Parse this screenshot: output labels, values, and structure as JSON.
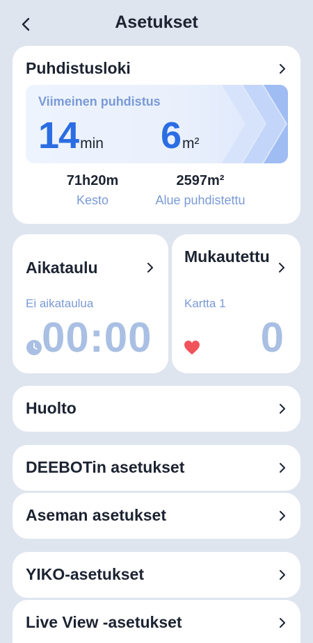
{
  "header": {
    "title": "Asetukset"
  },
  "cleaning_log": {
    "title": "Puhdistusloki",
    "last_label": "Viimeinen puhdistus",
    "last_duration_value": "14",
    "last_duration_unit": "min",
    "last_area_value": "6",
    "last_area_unit": "m²",
    "total_duration_value": "71h20m",
    "total_duration_label": "Kesto",
    "total_area_value": "2597m²",
    "total_area_label": "Alue puhdistettu"
  },
  "schedule": {
    "title": "Aikataulu",
    "subtitle": "Ei aikataulua",
    "time": "00:00"
  },
  "custom": {
    "title": "Mukautettu",
    "subtitle": "Kartta 1",
    "count": "0"
  },
  "rows": {
    "maintenance": "Huolto",
    "deebot_settings": "DEEBOTin asetukset",
    "station_settings": "Aseman asetukset",
    "yiko_settings": "YIKO-asetukset",
    "liveview_settings": "Live View -asetukset"
  },
  "colors": {
    "accent": "#2b6de2",
    "muted_blue": "#7a9ad6",
    "faded_blue": "#a9bfe3",
    "heart": "#f0545a",
    "background": "#dee5ef"
  }
}
